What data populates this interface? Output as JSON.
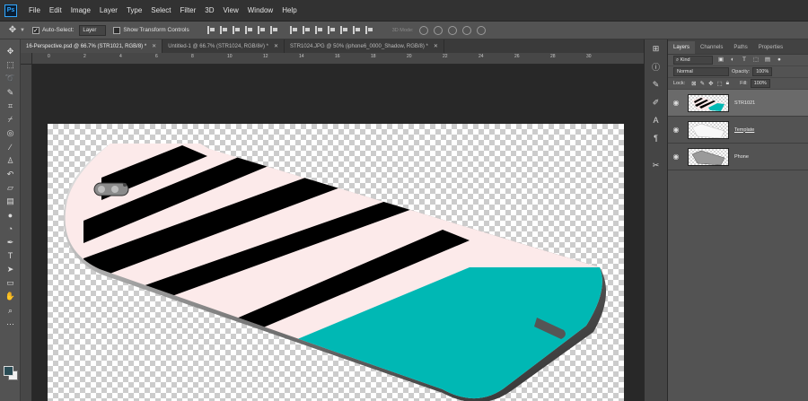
{
  "app": {
    "logo": "Ps"
  },
  "menu": [
    "File",
    "Edit",
    "Image",
    "Layer",
    "Type",
    "Select",
    "Filter",
    "3D",
    "View",
    "Window",
    "Help"
  ],
  "options": {
    "move_tool_icon": "move-icon",
    "auto_select_label": "Auto-Select:",
    "auto_select_checked": true,
    "auto_select_value": "Layer",
    "transform_controls_label": "Show Transform Controls",
    "mode_3d_label": "3D Mode:"
  },
  "tabs": [
    {
      "title": "16-Perspective.psd @ 66.7% (STR1021, RGB/8) *",
      "active": true
    },
    {
      "title": "Untitled-1 @ 66.7% (STR1024, RGB/8#) *",
      "active": false
    },
    {
      "title": "STR1024.JPG @ 50% (iphone6_0000_Shadow, RGB/8) *",
      "active": false
    }
  ],
  "ruler": {
    "h_labels": [
      "0",
      "2",
      "4",
      "6",
      "8",
      "10",
      "12",
      "14",
      "16",
      "18",
      "20",
      "22",
      "24",
      "26",
      "28",
      "30"
    ]
  },
  "layers_panel": {
    "tabs": [
      "Layers",
      "Channels",
      "Paths",
      "Properties"
    ],
    "active_tab": "Layers",
    "kind_label": "Kind",
    "blend_mode": "Normal",
    "opacity_label": "Opacity:",
    "opacity_value": "100%",
    "lock_label": "Lock:",
    "fill_label": "Fill:",
    "fill_value": "100%",
    "layers": [
      {
        "name": "STR1021",
        "selected": true,
        "visible": true,
        "underline": false
      },
      {
        "name": "Template",
        "selected": false,
        "visible": true,
        "underline": true
      },
      {
        "name": "Phone",
        "selected": false,
        "visible": true,
        "underline": false
      }
    ]
  },
  "colors": {
    "teal": "#00b8b4",
    "stripe_pink": "#fceaea",
    "stripe_black": "#000000",
    "foreground_swatch": "#2a4c55",
    "background_swatch": "#f2f2f2"
  }
}
